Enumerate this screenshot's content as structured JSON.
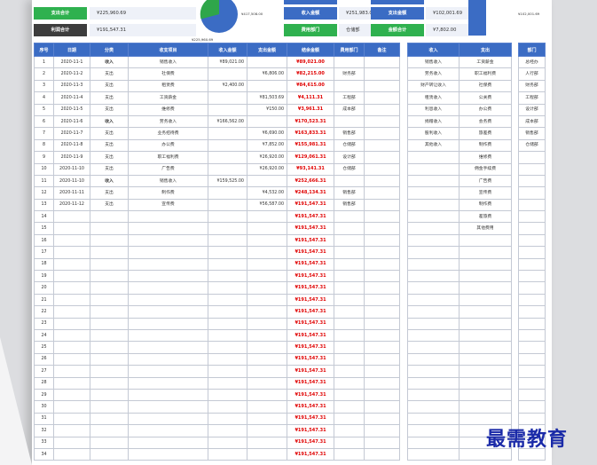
{
  "summary": {
    "expense_total_label": "支出合计",
    "expense_total_value": "¥225,960.69",
    "balance_total_label": "利润合计",
    "balance_total_value": "¥191,547.31",
    "income_total_label": "收入金额",
    "income_total_value": "¥251,983.00",
    "expense_amount_label": "支出金额",
    "expense_amount_value": "¥102,001.69",
    "dept_label": "费用部门",
    "dept_value": "仓储部",
    "amount_total_label": "金额合计",
    "amount_total_value": "¥7,802.00",
    "pie_label_left": "¥225,960.69",
    "pie_label_right": "¥417,508.00",
    "top_right_value": "¥102,001.69"
  },
  "colors": {
    "header_blue": "#3b6cc4",
    "label_green": "#2fb14f",
    "balance_red": "#e00000",
    "income_red": "#d40000"
  },
  "main_table": {
    "headers": [
      "序号",
      "日期",
      "分类",
      "收支项目",
      "收入金额",
      "支出金额",
      "结余金额",
      "费用部门",
      "备注"
    ],
    "rows": [
      {
        "no": "1",
        "date": "2020-11-1",
        "type": "收入",
        "item": "销售收入",
        "income": "¥89,021.00",
        "expense": "",
        "balance": "¥89,021.00",
        "dept": "",
        "note": ""
      },
      {
        "no": "2",
        "date": "2020-11-2",
        "type": "支出",
        "item": "社保费",
        "income": "",
        "expense": "¥6,806.00",
        "balance": "¥82,215.00",
        "dept": "财务部",
        "note": ""
      },
      {
        "no": "3",
        "date": "2020-11-3",
        "type": "支出",
        "item": "租赁费",
        "income": "¥2,400.00",
        "expense": "",
        "balance": "¥84,615.00",
        "dept": "",
        "note": ""
      },
      {
        "no": "4",
        "date": "2020-11-4",
        "type": "支出",
        "item": "工资薪金",
        "income": "",
        "expense": "¥81,503.69",
        "balance": "¥4,111.31",
        "dept": "工程部",
        "note": ""
      },
      {
        "no": "5",
        "date": "2020-11-5",
        "type": "支出",
        "item": "维修费",
        "income": "",
        "expense": "¥150.00",
        "balance": "¥3,961.31",
        "dept": "成本部",
        "note": ""
      },
      {
        "no": "6",
        "date": "2020-11-6",
        "type": "收入",
        "item": "劳务收入",
        "income": "¥166,562.00",
        "expense": "",
        "balance": "¥170,523.31",
        "dept": "",
        "note": ""
      },
      {
        "no": "7",
        "date": "2020-11-7",
        "type": "支出",
        "item": "业务招待费",
        "income": "",
        "expense": "¥6,690.00",
        "balance": "¥163,833.31",
        "dept": "销售部",
        "note": ""
      },
      {
        "no": "8",
        "date": "2020-11-8",
        "type": "支出",
        "item": "办公费",
        "income": "",
        "expense": "¥7,852.00",
        "balance": "¥155,981.31",
        "dept": "仓储部",
        "note": ""
      },
      {
        "no": "9",
        "date": "2020-11-9",
        "type": "支出",
        "item": "职工福利费",
        "income": "",
        "expense": "¥26,920.00",
        "balance": "¥129,061.31",
        "dept": "设计部",
        "note": ""
      },
      {
        "no": "10",
        "date": "2020-11-10",
        "type": "支出",
        "item": "广告费",
        "income": "",
        "expense": "¥26,920.00",
        "balance": "¥93,141.31",
        "dept": "仓储部",
        "note": ""
      },
      {
        "no": "11",
        "date": "2020-11-10",
        "type": "收入",
        "item": "销售收入",
        "income": "¥159,525.00",
        "expense": "",
        "balance": "¥252,666.31",
        "dept": "",
        "note": ""
      },
      {
        "no": "12",
        "date": "2020-11-11",
        "type": "支出",
        "item": "制作费",
        "income": "",
        "expense": "¥4,532.00",
        "balance": "¥248,134.31",
        "dept": "销售部",
        "note": ""
      },
      {
        "no": "13",
        "date": "2020-11-12",
        "type": "支出",
        "item": "宣传费",
        "income": "",
        "expense": "¥56,587.00",
        "balance": "¥191,547.31",
        "dept": "销售部",
        "note": ""
      },
      {
        "no": "14",
        "date": "",
        "type": "",
        "item": "",
        "income": "",
        "expense": "",
        "balance": "¥191,547.31",
        "dept": "",
        "note": ""
      },
      {
        "no": "15",
        "date": "",
        "type": "",
        "item": "",
        "income": "",
        "expense": "",
        "balance": "¥191,547.31",
        "dept": "",
        "note": ""
      },
      {
        "no": "16",
        "date": "",
        "type": "",
        "item": "",
        "income": "",
        "expense": "",
        "balance": "¥191,547.31",
        "dept": "",
        "note": ""
      },
      {
        "no": "17",
        "date": "",
        "type": "",
        "item": "",
        "income": "",
        "expense": "",
        "balance": "¥191,547.31",
        "dept": "",
        "note": ""
      },
      {
        "no": "18",
        "date": "",
        "type": "",
        "item": "",
        "income": "",
        "expense": "",
        "balance": "¥191,547.31",
        "dept": "",
        "note": ""
      },
      {
        "no": "19",
        "date": "",
        "type": "",
        "item": "",
        "income": "",
        "expense": "",
        "balance": "¥191,547.31",
        "dept": "",
        "note": ""
      },
      {
        "no": "20",
        "date": "",
        "type": "",
        "item": "",
        "income": "",
        "expense": "",
        "balance": "¥191,547.31",
        "dept": "",
        "note": ""
      },
      {
        "no": "21",
        "date": "",
        "type": "",
        "item": "",
        "income": "",
        "expense": "",
        "balance": "¥191,547.31",
        "dept": "",
        "note": ""
      },
      {
        "no": "22",
        "date": "",
        "type": "",
        "item": "",
        "income": "",
        "expense": "",
        "balance": "¥191,547.31",
        "dept": "",
        "note": ""
      },
      {
        "no": "23",
        "date": "",
        "type": "",
        "item": "",
        "income": "",
        "expense": "",
        "balance": "¥191,547.31",
        "dept": "",
        "note": ""
      },
      {
        "no": "24",
        "date": "",
        "type": "",
        "item": "",
        "income": "",
        "expense": "",
        "balance": "¥191,547.31",
        "dept": "",
        "note": ""
      },
      {
        "no": "25",
        "date": "",
        "type": "",
        "item": "",
        "income": "",
        "expense": "",
        "balance": "¥191,547.31",
        "dept": "",
        "note": ""
      },
      {
        "no": "26",
        "date": "",
        "type": "",
        "item": "",
        "income": "",
        "expense": "",
        "balance": "¥191,547.31",
        "dept": "",
        "note": ""
      },
      {
        "no": "27",
        "date": "",
        "type": "",
        "item": "",
        "income": "",
        "expense": "",
        "balance": "¥191,547.31",
        "dept": "",
        "note": ""
      },
      {
        "no": "28",
        "date": "",
        "type": "",
        "item": "",
        "income": "",
        "expense": "",
        "balance": "¥191,547.31",
        "dept": "",
        "note": ""
      },
      {
        "no": "29",
        "date": "",
        "type": "",
        "item": "",
        "income": "",
        "expense": "",
        "balance": "¥191,547.31",
        "dept": "",
        "note": ""
      },
      {
        "no": "30",
        "date": "",
        "type": "",
        "item": "",
        "income": "",
        "expense": "",
        "balance": "¥191,547.31",
        "dept": "",
        "note": ""
      },
      {
        "no": "31",
        "date": "",
        "type": "",
        "item": "",
        "income": "",
        "expense": "",
        "balance": "¥191,547.31",
        "dept": "",
        "note": ""
      },
      {
        "no": "32",
        "date": "",
        "type": "",
        "item": "",
        "income": "",
        "expense": "",
        "balance": "¥191,547.31",
        "dept": "",
        "note": ""
      },
      {
        "no": "33",
        "date": "",
        "type": "",
        "item": "",
        "income": "",
        "expense": "",
        "balance": "¥191,547.31",
        "dept": "",
        "note": ""
      },
      {
        "no": "34",
        "date": "",
        "type": "",
        "item": "",
        "income": "",
        "expense": "",
        "balance": "¥191,547.31",
        "dept": "",
        "note": ""
      }
    ]
  },
  "category_table": {
    "headers": [
      "收入",
      "支出"
    ],
    "income": [
      "销售收入",
      "劳务收入",
      "财产转让收入",
      "租赁收入",
      "利息收入",
      "捐赠收入",
      "股利收入",
      "其他收入"
    ],
    "expense": [
      "工资薪金",
      "职工福利费",
      "社保费",
      "公关费",
      "办公费",
      "会务费",
      "旅差费",
      "制作费",
      "维修费",
      "佣金手续费",
      "广告费",
      "宣传费",
      "制作费",
      "差旅费",
      "其他费用"
    ]
  },
  "dept_table": {
    "header": "部门",
    "items": [
      "总经办",
      "人行部",
      "财务部",
      "工程部",
      "设计部",
      "成本部",
      "销售部",
      "仓储部"
    ]
  },
  "watermark": "最需教育"
}
